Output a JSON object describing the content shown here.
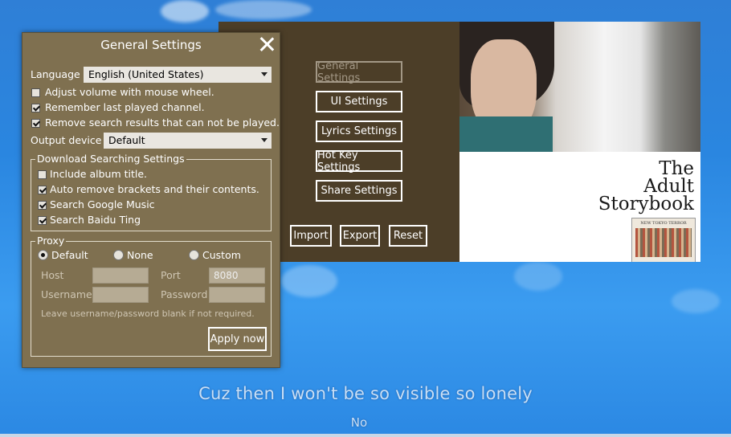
{
  "player": {
    "buttons": {
      "general": "General Settings",
      "ui": "UI Settings",
      "lyrics": "Lyrics Settings",
      "hotkey": "Hot Key Settings",
      "share": "Share Settings",
      "import": "Import",
      "export": "Export",
      "reset": "Reset"
    },
    "album": {
      "title_line1": "The",
      "title_line2": "Adult",
      "title_line3": "Storybook",
      "mini_cover_text": "NEW TOKYO TERROR"
    }
  },
  "dialog": {
    "title": "General Settings",
    "language_label": "Language",
    "language_value": "English (United States)",
    "options": [
      {
        "label": "Adjust volume with mouse wheel.",
        "checked": false
      },
      {
        "label": "Remember last played channel.",
        "checked": true
      },
      {
        "label": "Remove search results that can not be played.",
        "checked": true
      }
    ],
    "output_label": "Output device",
    "output_value": "Default",
    "download_group": {
      "legend": "Download Searching Settings",
      "items": [
        {
          "label": "Include album title.",
          "checked": false
        },
        {
          "label": "Auto remove brackets and their contents.",
          "checked": true
        },
        {
          "label": "Search Google Music",
          "checked": true
        },
        {
          "label": "Search Baidu Ting",
          "checked": true
        }
      ]
    },
    "proxy": {
      "legend": "Proxy",
      "modes": [
        "Default",
        "None",
        "Custom"
      ],
      "selected": "Default",
      "host_label": "Host",
      "host_value": "",
      "port_label": "Port",
      "port_value": "8080",
      "username_label": "Username",
      "username_value": "",
      "password_label": "Password",
      "password_value": "",
      "hint": "Leave username/password blank if not required."
    },
    "apply_label": "Apply now"
  },
  "lyrics": {
    "current": "Cuz then I won't be so visible so lonely",
    "next": "No"
  }
}
